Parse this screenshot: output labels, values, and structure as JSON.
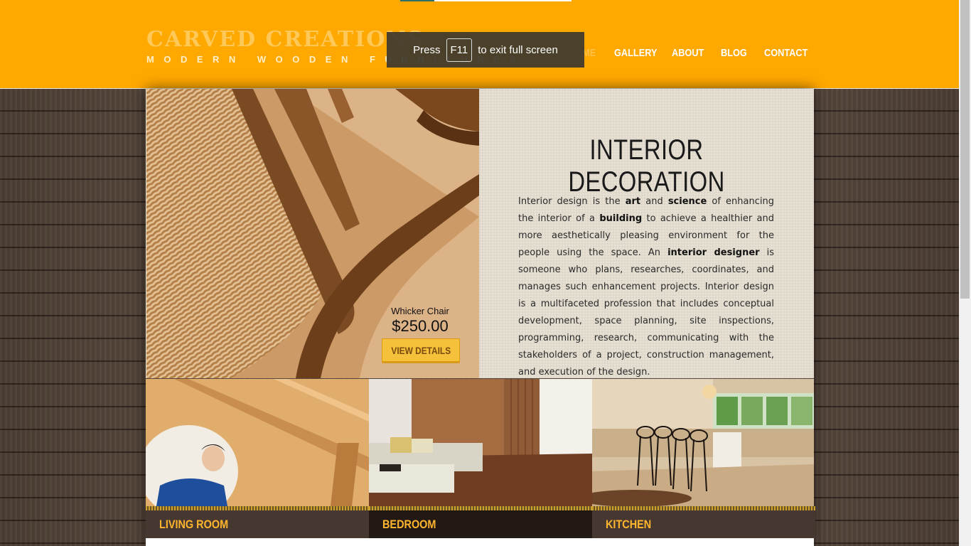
{
  "header": {
    "logo_title": "CARVED CREATIONS",
    "logo_subtitle": "MODERN WOODEN FURNITURES",
    "nav": [
      {
        "label": "HOME"
      },
      {
        "label": "GALLERY"
      },
      {
        "label": "ABOUT"
      },
      {
        "label": "BLOG"
      },
      {
        "label": "CONTACT"
      }
    ]
  },
  "toast": {
    "press": "Press",
    "key": "F11",
    "message": "to exit full screen"
  },
  "hero": {
    "product_name": "Whicker Chair",
    "product_price": "$250.00",
    "view_details_label": "VIEW DETAILS",
    "heading": "INTERIOR DECORATION",
    "paragraph": [
      {
        "t": "Interior design is the ",
        "b": false
      },
      {
        "t": "art",
        "b": true
      },
      {
        "t": " and ",
        "b": false
      },
      {
        "t": "science",
        "b": true
      },
      {
        "t": " of enhancing the interior of a ",
        "b": false
      },
      {
        "t": "building",
        "b": true
      },
      {
        "t": " to achieve a healthier and more aesthetically pleasing environment for the people using the space. An ",
        "b": false
      },
      {
        "t": "interior designer",
        "b": true
      },
      {
        "t": " is someone who plans, researches, coordinates, and manages such enhancement projects. Interior design is a multifaceted profession that includes conceptual development, space planning, site inspections, programming, research, communicating with the stakeholders of a project, construction management, and execution of the design.",
        "b": false
      }
    ]
  },
  "categories": [
    {
      "label": "LIVING ROOM"
    },
    {
      "label": "BEDROOM"
    },
    {
      "label": "KITCHEN"
    }
  ],
  "colors": {
    "header": "#ffa800",
    "accent": "#ffb52e",
    "category_bar": "#463830"
  }
}
